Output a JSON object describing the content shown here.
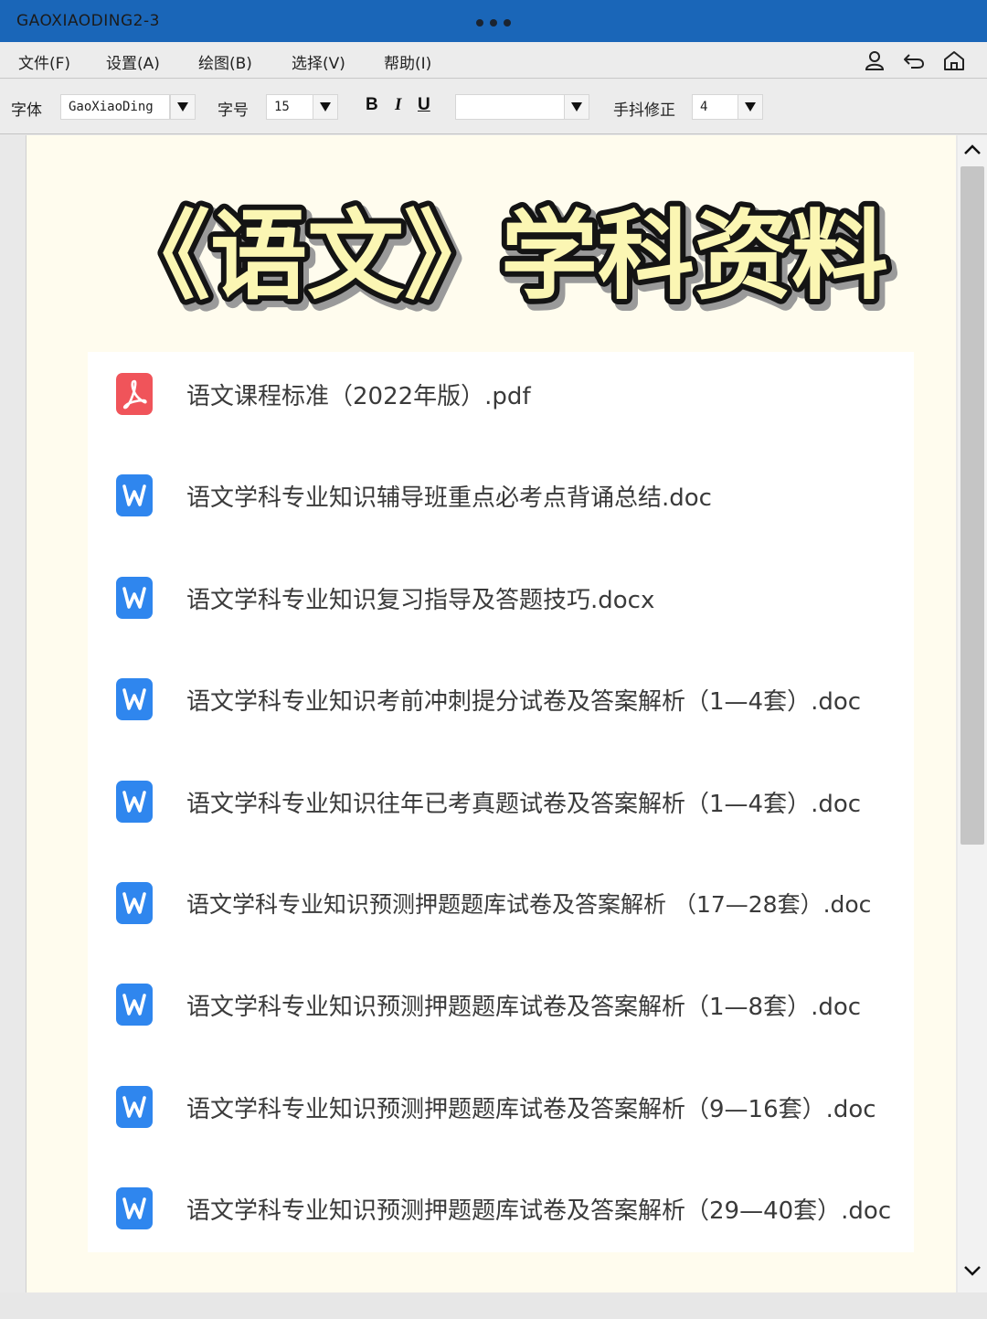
{
  "window": {
    "title": "GAOXIAODING2-3"
  },
  "menu": [
    {
      "label": "文件(F)"
    },
    {
      "label": "设置(A)"
    },
    {
      "label": "绘图(B)"
    },
    {
      "label": "选择(V)"
    },
    {
      "label": "帮助(I)"
    }
  ],
  "menu_icons": [
    "user-icon",
    "undo-icon",
    "home-icon"
  ],
  "toolbar": {
    "font_label": "字体",
    "font_value": "GaoXiaoDing",
    "size_label": "字号",
    "size_value": "15",
    "bold": "B",
    "italic": "I",
    "underline": "U",
    "color_value": "",
    "smoothing_label": "手抖修正",
    "smoothing_value": "4"
  },
  "document": {
    "heading": "《语文》学科资料",
    "heading_fill": "#fbf6b3",
    "files": [
      {
        "icon": "pdf-icon",
        "name": "语文课程标准（2022年版）.pdf"
      },
      {
        "icon": "word-icon",
        "name": "语文学科专业知识辅导班重点必考点背诵总结.doc"
      },
      {
        "icon": "word-icon",
        "name": "语文学科专业知识复习指导及答题技巧.docx"
      },
      {
        "icon": "word-icon",
        "name": "语文学科专业知识考前冲刺提分试卷及答案解析（1—4套）.doc"
      },
      {
        "icon": "word-icon",
        "name": "语文学科专业知识往年已考真题试卷及答案解析（1—4套）.doc"
      },
      {
        "icon": "word-icon",
        "name": "语文学科专业知识预测押题题库试卷及答案解析 （17—28套）.doc"
      },
      {
        "icon": "word-icon",
        "name": "语文学科专业知识预测押题题库试卷及答案解析（1—8套）.doc"
      },
      {
        "icon": "word-icon",
        "name": "语文学科专业知识预测押题题库试卷及答案解析（9—16套）.doc"
      },
      {
        "icon": "word-icon",
        "name": "语文学科专业知识预测押题题库试卷及答案解析（29—40套）.doc"
      }
    ]
  },
  "colors": {
    "titlebar": "#1a66b8",
    "page_bg": "#fffcee",
    "pdf_red": "#f0545a",
    "word_blue": "#2f86ee"
  }
}
